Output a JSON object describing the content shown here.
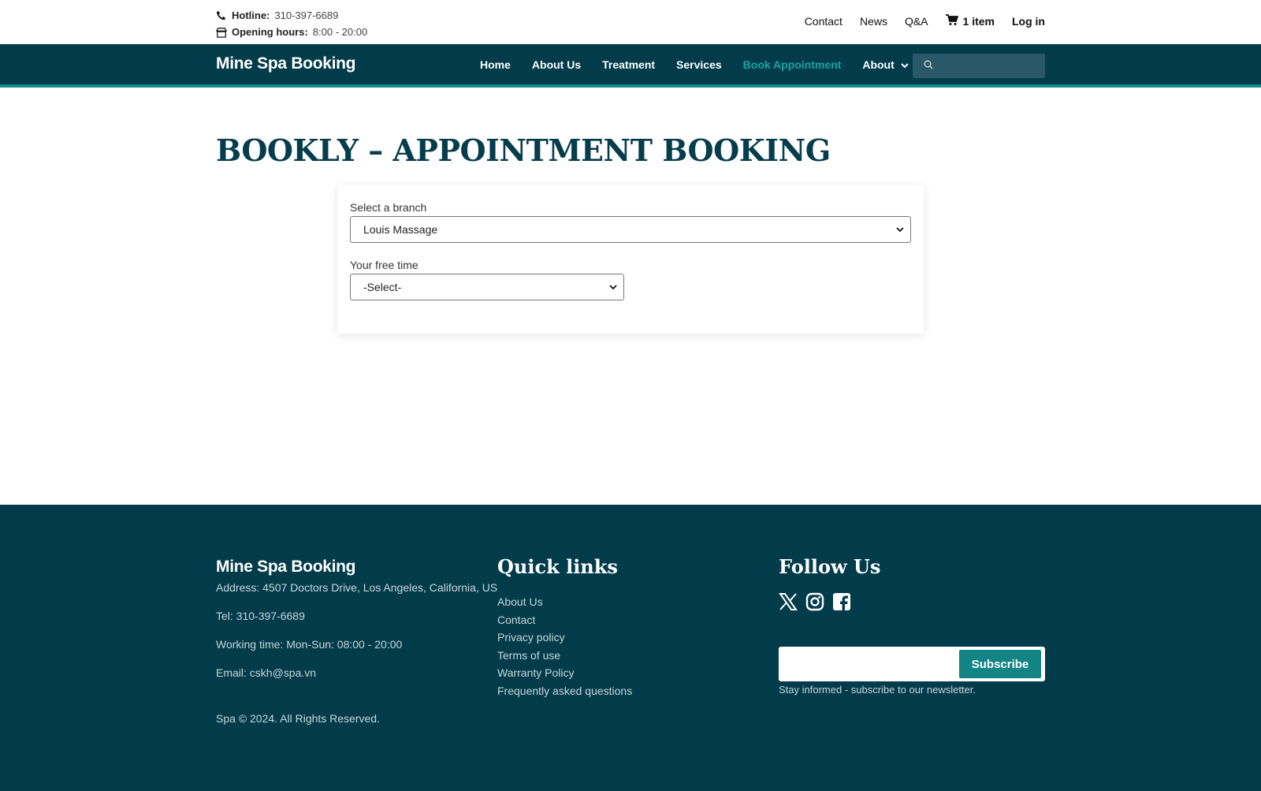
{
  "topbar": {
    "hotline_label": "Hotline:",
    "hotline_value": "310-397-6689",
    "hours_label": "Opening hours:",
    "hours_value": "8:00 - 20:00",
    "links": {
      "contact": "Contact",
      "news": "News",
      "qa": "Q&A",
      "cart": "1 item",
      "login": "Log in"
    }
  },
  "navbar": {
    "brand": "Mine Spa Booking",
    "items": [
      "Home",
      "About Us",
      "Treatment",
      "Services",
      "Book Appointment",
      "About"
    ],
    "active_item": "Book Appointment",
    "search_placeholder": ""
  },
  "main": {
    "title": "BOOKLY – APPOINTMENT BOOKING",
    "branch_label": "Select a branch",
    "branch_value": "Louis Massage",
    "time_label": "Your free time",
    "time_value": "-Select-"
  },
  "footer": {
    "brand": "Mine Spa Booking",
    "address": "Address: 4507 Doctors Drive, Los Angeles, California, US",
    "tel": "Tel: 310-397-6689",
    "working": "Working time: Mon-Sun: 08:00 - 20:00",
    "email": "Email: cskh@spa.vn",
    "copyright": "Spa © 2024. All Rights Reserved.",
    "quick_links_title": "Quick links",
    "quick_links": [
      "About Us",
      "Contact",
      "Privacy policy",
      "Terms of use",
      "Warranty Policy",
      "Frequently asked questions"
    ],
    "follow_title": "Follow Us",
    "social_icons": [
      "x-icon",
      "instagram-icon",
      "facebook-icon"
    ],
    "subscribe_label": "Subscribe",
    "newsletter_placeholder": "",
    "newsletter_note": "Stay informed - subscribe to our newsletter."
  },
  "colors": {
    "primary": "#023c4b",
    "accent": "#138a8a",
    "active": "#1aa59a"
  }
}
